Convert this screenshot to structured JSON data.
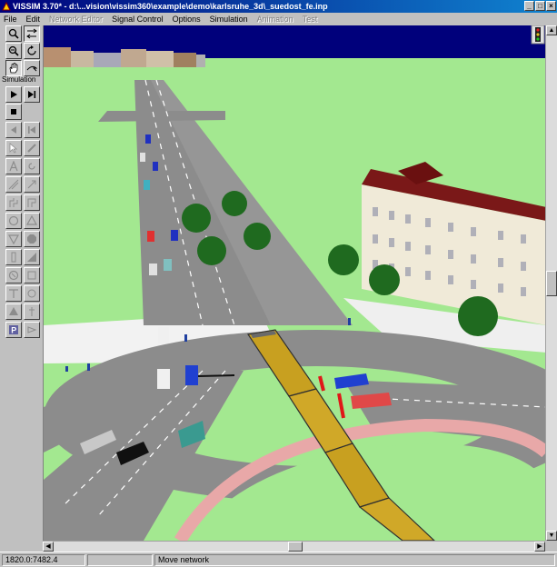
{
  "window": {
    "title": "VISSIM 3.70* - d:\\...vision\\vissim360\\example\\demo\\karlsruhe_3d\\_suedost_fe.inp",
    "buttons": {
      "minimize": "_",
      "maximize": "□",
      "close": "×"
    }
  },
  "menu": [
    {
      "label": "File",
      "enabled": true
    },
    {
      "label": "Edit",
      "enabled": true
    },
    {
      "label": "Network Editor",
      "enabled": false
    },
    {
      "label": "Signal Control",
      "enabled": true
    },
    {
      "label": "Options",
      "enabled": true
    },
    {
      "label": "Simulation",
      "enabled": true
    },
    {
      "label": "Animation",
      "enabled": false
    },
    {
      "label": "Test",
      "enabled": false
    }
  ],
  "toolbar": {
    "simulation_label": "Simulation",
    "tools": [
      {
        "name": "zoom-in-icon",
        "glyph": "🔍"
      },
      {
        "name": "3d-mode-icon",
        "glyph": "⇄"
      },
      {
        "name": "zoom-out-icon",
        "glyph": "🔍"
      },
      {
        "name": "rotate-icon",
        "glyph": "↻"
      },
      {
        "name": "pan-hand-icon",
        "glyph": "✋"
      },
      {
        "name": "fly-icon",
        "glyph": "➤"
      },
      {
        "name": "play-icon",
        "glyph": "▶"
      },
      {
        "name": "step-forward-icon",
        "glyph": "▶|"
      },
      {
        "name": "stop-icon",
        "glyph": "■"
      }
    ]
  },
  "status": {
    "coordinates": "1820.0:7482.4",
    "mode": "Move network"
  },
  "colors": {
    "sky": "#00007b",
    "grass": "#a3e890",
    "road": "#8c8c8c",
    "tram": "#c8a020"
  }
}
